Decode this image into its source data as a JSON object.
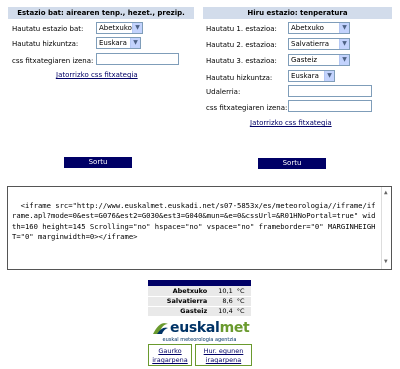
{
  "left_panel": {
    "title": "Estazio bat: airearen tenp., hezet., prezip.",
    "station_label": "Hautatu estazio bat:",
    "station_value": "Abetxuko",
    "language_label": "Hautatu hizkuntza:",
    "language_value": "Euskara",
    "css_label": "css fitxategiaren izena:",
    "css_value": "",
    "css_link": "Jatorrizko css fitxategia",
    "submit_label": "Sortu"
  },
  "right_panel": {
    "title": "Hiru estazio: tenperatura",
    "station1_label": "Hautatu 1. estazioa:",
    "station1_value": "Abetxuko",
    "station2_label": "Hautatu 2. estazioa:",
    "station2_value": "Salvatierra",
    "station3_label": "Hautatu 3. estazioa:",
    "station3_value": "Gasteiz",
    "language_label": "Hautatu hizkuntza:",
    "language_value": "Euskara",
    "town_label": "Udalerria:",
    "town_value": "",
    "css_label": "css fitxategiaren izena:",
    "css_value": "",
    "css_link": "Jatorrizko css fitxategia",
    "submit_label": "Sortu"
  },
  "code_box": {
    "text": "<iframe src=\"http://www.euskalmet.euskadi.net/s07-5853x/es/meteorologia//iframe/iframe.apl?mode=0&est=G076&est2=G030&est3=G040&mun=&e=0&cssUrl=&R01HNoPortal=true\" width=160 height=145 Scrolling=\"no\" hspace=\"no\" vspace=\"no\" frameborder=\"0\" MARGINHEIGHT=\"0\" marginwidth=0></iframe>"
  },
  "widget": {
    "rows": [
      {
        "station": "Abetxuko",
        "value": "10,1",
        "unit": "°C"
      },
      {
        "station": "Salvatierra",
        "value": "8,6",
        "unit": "°C"
      },
      {
        "station": "Gasteiz",
        "value": "10,4",
        "unit": "°C"
      }
    ],
    "logo_text_a": "euskal",
    "logo_text_b": "met",
    "logo_subtitle": "euskal meteorologia agentzia",
    "link_today": "Gaurko iragarpena",
    "link_next": "Hur. egunen iragarpena"
  },
  "colors": {
    "panel_header": "#d2dceb",
    "button": "#000066",
    "logo_green": "#6a9a2e",
    "logo_blue": "#003366"
  },
  "icons": [
    "chevron-down-icon",
    "scroll-up-arrow-icon",
    "scroll-down-arrow-icon",
    "euskalmet-logo-icon"
  ]
}
